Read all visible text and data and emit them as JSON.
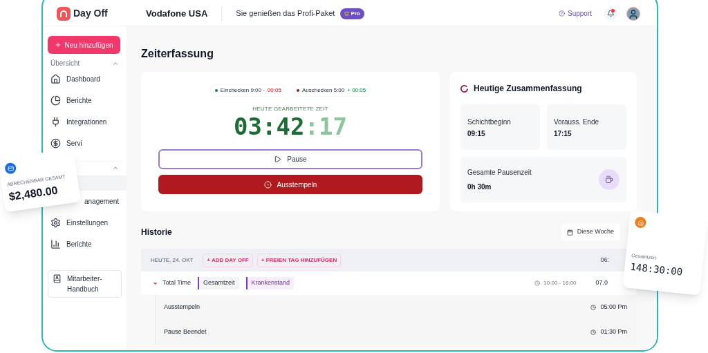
{
  "header": {
    "brand": "Day Off",
    "company": "Vodafone USA",
    "plan_text": "Sie genießen das Profi-Paket",
    "plan_badge": "Pro",
    "support": "Support",
    "notifications_unread": true
  },
  "sidebar": {
    "new_button": "Neu hinzufügen",
    "section": "Übersicht",
    "section_expanded": true,
    "items": [
      {
        "label": "Dashboard"
      },
      {
        "label": "Berichte"
      },
      {
        "label": "Integrationen"
      },
      {
        "label": "Servi"
      }
    ],
    "second_section_expanded": true,
    "items_2": [
      {
        "label": "anagement"
      },
      {
        "label": "Einstellungen"
      },
      {
        "label": "Berichte"
      }
    ],
    "handbook": "Mitarbeiter-Handbuch"
  },
  "page_title": "Zeiterfassung",
  "clock": {
    "pills": [
      {
        "label": "Einchecken 9:00 -",
        "delta": "00:05",
        "kind": "late",
        "color": "#15803d"
      },
      {
        "label": "Auschecken 5:00",
        "delta": "+ 00:05",
        "kind": "over",
        "color": "#991b1b"
      }
    ],
    "caption": "HEUTE GEARBEITETE ZEIT",
    "hours_minutes": "03:42",
    "seconds": ":17",
    "pause_button": "Pause",
    "stop_button": "Ausstempeln"
  },
  "summary": {
    "title": "Heutige Zusammenfassung",
    "tiles": [
      {
        "label": "Schichtbeginn",
        "value": "09:15"
      },
      {
        "label": "Vorauss. Ende",
        "value": "17:15"
      }
    ],
    "break": {
      "label": "Gesamte Pausenzeit",
      "value": "0h 30m"
    }
  },
  "history": {
    "title": "Historie",
    "range_button": "Diese Woche",
    "day": {
      "date": "HEUTE, 24. OKT",
      "actions": [
        "+ ADD DAY OFF",
        "+ FREIEN TAG HINZUFÜGEN"
      ],
      "total": "06:"
    },
    "group": {
      "label": "Total Time",
      "expanded": true,
      "tags": [
        {
          "label": "Gesamtzeit",
          "kind": "neutral"
        },
        {
          "label": "Krankenstand",
          "kind": "sick"
        }
      ],
      "range": "10:00 - 16:00",
      "total": "07.0"
    },
    "entries": [
      {
        "label": "Ausstempeln",
        "time": "05:00 Pm"
      },
      {
        "label": "Pause Beendet",
        "time": "01:30 Pm"
      }
    ]
  },
  "floating_cards": [
    {
      "label": "ABRECHENBAR GESAMT",
      "value": "$2,480.00",
      "kind": "billing"
    },
    {
      "label": "Gesamtzeit",
      "value": "148:30:00",
      "kind": "hours"
    }
  ]
}
